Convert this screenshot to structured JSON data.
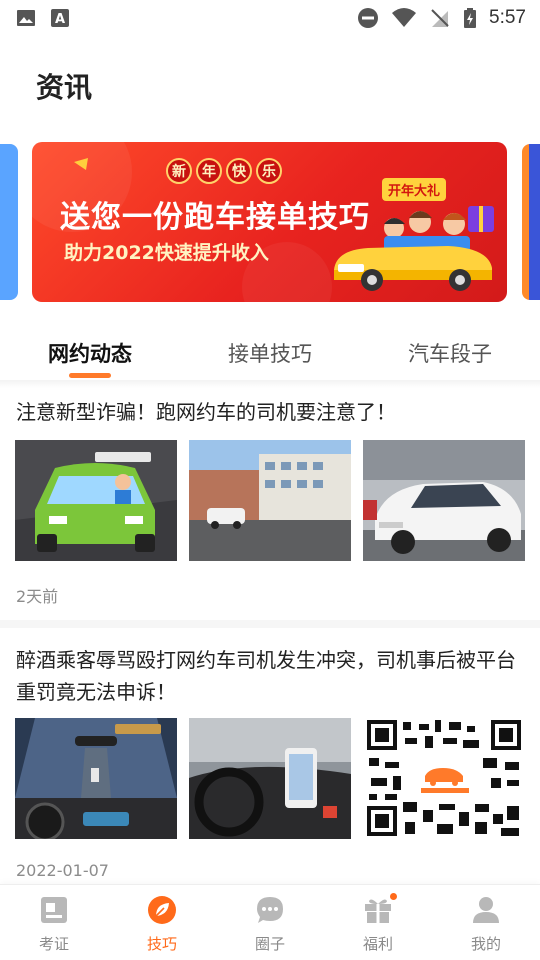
{
  "status_bar": {
    "time": "5:57"
  },
  "header": {
    "title": "资讯"
  },
  "banner": {
    "badge_chars": [
      "新",
      "年",
      "快",
      "乐"
    ],
    "headline": "送您一份跑车接单技巧",
    "subline": "助力2022快速提升收入",
    "tag": "开年大礼"
  },
  "tabs": [
    {
      "label": "网约动态",
      "active": true
    },
    {
      "label": "接单技巧",
      "active": false
    },
    {
      "label": "汽车段子",
      "active": false
    }
  ],
  "articles": [
    {
      "title": "注意新型诈骗！跑网约车的司机要注意了！",
      "date": "2天前"
    },
    {
      "title": "醉酒乘客辱骂殴打网约车司机发生冲突，司机事后被平台重罚竟无法申诉！",
      "date": "2022-01-07"
    }
  ],
  "bottom_nav": [
    {
      "label": "考证",
      "icon": "certificate-icon",
      "active": false
    },
    {
      "label": "技巧",
      "icon": "leaf-icon",
      "active": true
    },
    {
      "label": "圈子",
      "icon": "chat-bubble-icon",
      "active": false
    },
    {
      "label": "福利",
      "icon": "gift-icon",
      "active": false,
      "has_dot": true
    },
    {
      "label": "我的",
      "icon": "user-icon",
      "active": false
    }
  ],
  "colors": {
    "accent": "#ff6a1a",
    "banner_red": "#e8231f"
  }
}
